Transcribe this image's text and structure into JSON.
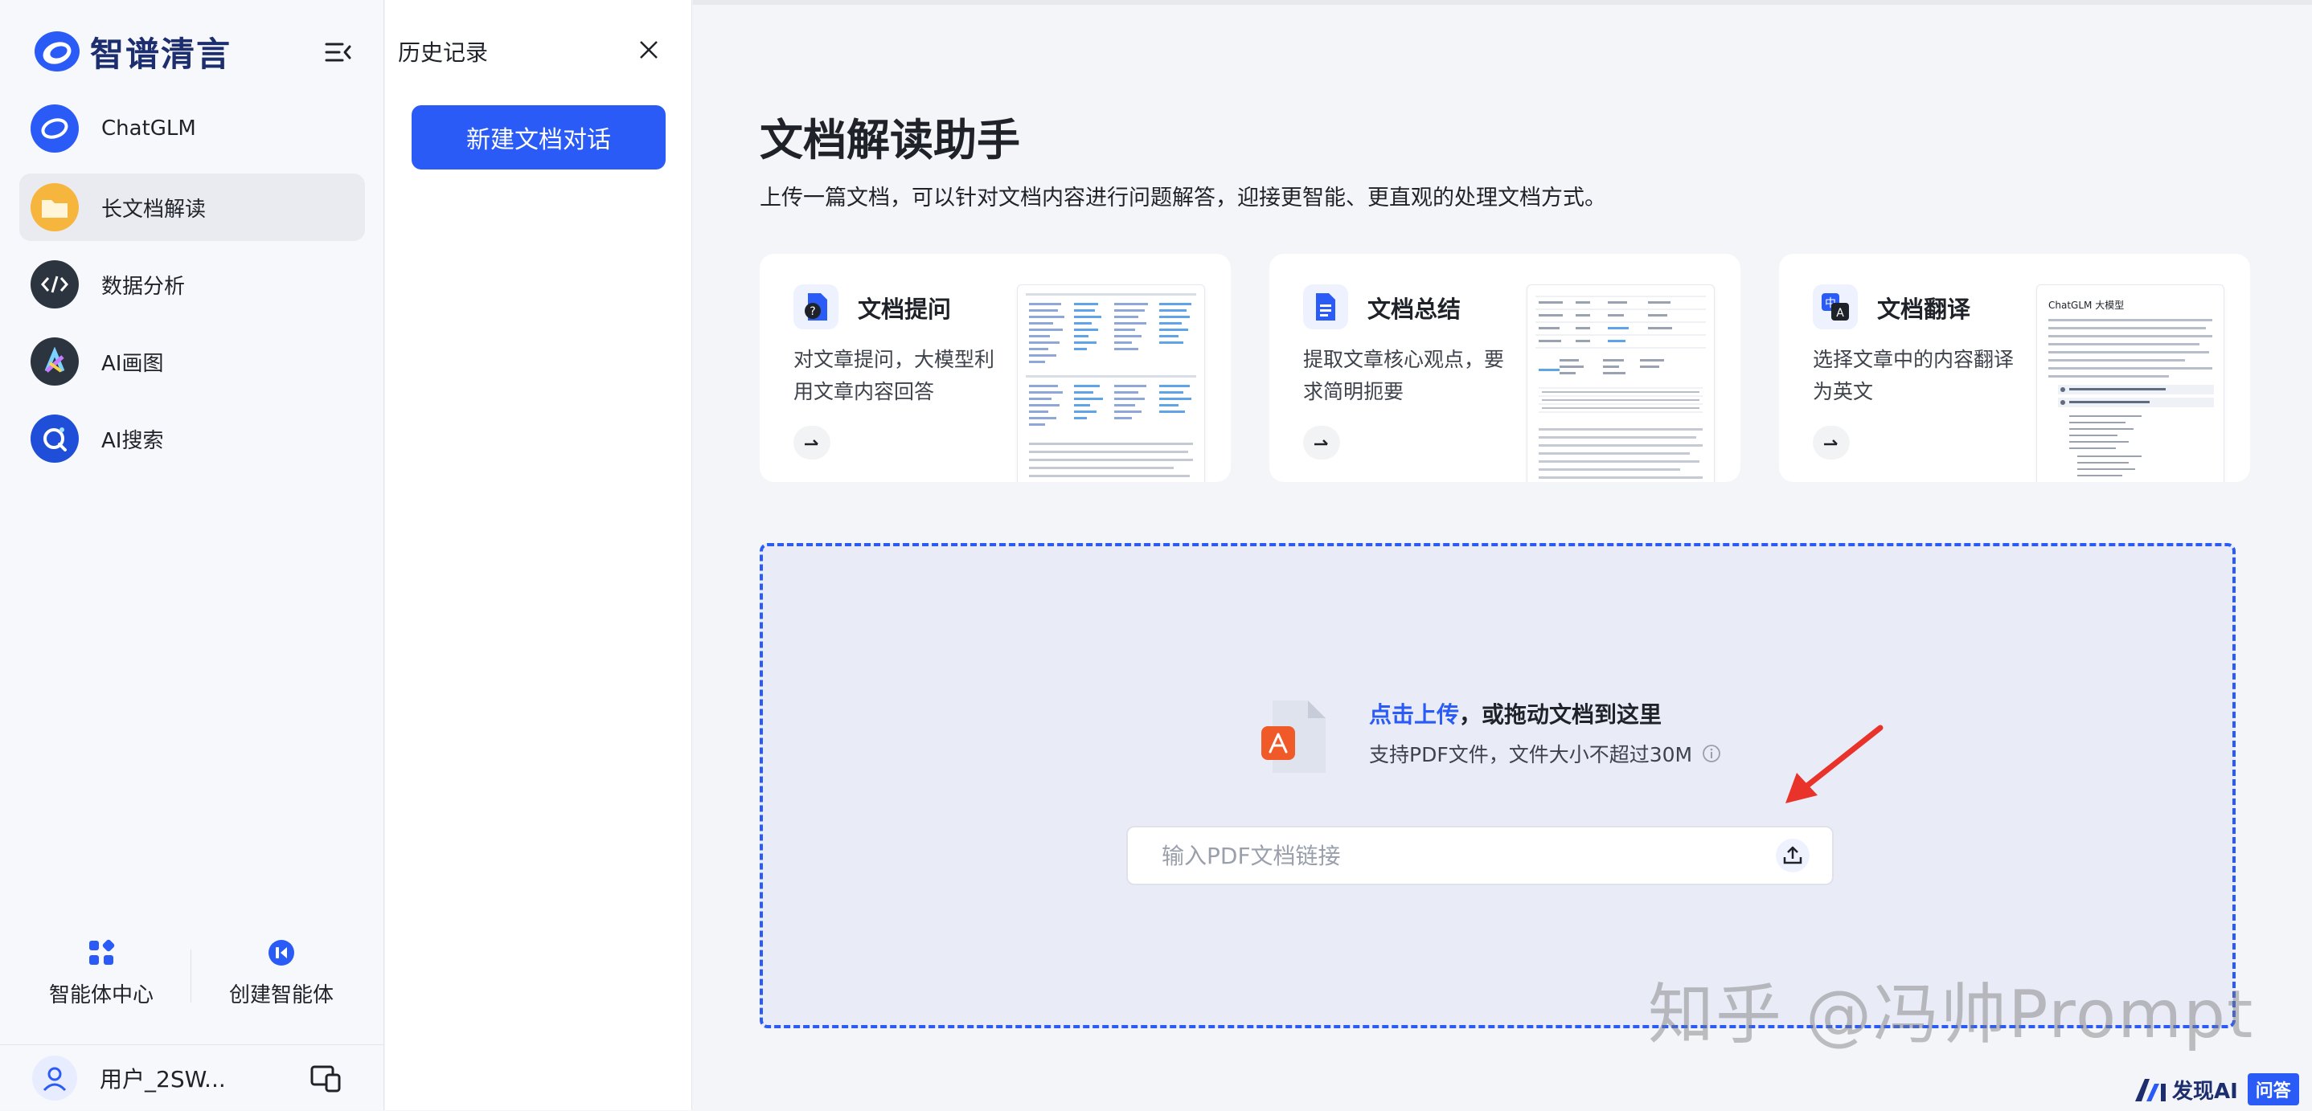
{
  "sidebar": {
    "brand": "智谱清言",
    "nav": [
      {
        "label": "ChatGLM",
        "icon": "chatglm-logo-icon",
        "active": false
      },
      {
        "label": "长文档解读",
        "icon": "folder-icon",
        "active": true
      },
      {
        "label": "数据分析",
        "icon": "code-icon",
        "active": false
      },
      {
        "label": "AI画图",
        "icon": "ai-paint-icon",
        "active": false
      },
      {
        "label": "AI搜索",
        "icon": "ai-search-icon",
        "active": false
      }
    ],
    "bottom": [
      {
        "label": "智能体中心",
        "icon": "apps-grid-icon"
      },
      {
        "label": "创建智能体",
        "icon": "create-agent-icon"
      }
    ],
    "user": {
      "name": "用户_2SW..."
    }
  },
  "history": {
    "title": "历史记录",
    "new_button": "新建文档对话"
  },
  "main": {
    "title": "文档解读助手",
    "subtitle": "上传一篇文档，可以针对文档内容进行问题解答，迎接更智能、更直观的处理文档方式。",
    "cards": [
      {
        "title": "文档提问",
        "desc": "对文章提问，大模型利用文章内容回答",
        "icon": "doc-question-icon"
      },
      {
        "title": "文档总结",
        "desc": "提取文章核心观点，要求简明扼要",
        "icon": "doc-summary-icon"
      },
      {
        "title": "文档翻译",
        "desc": "选择文章中的内容翻译为英文",
        "icon": "doc-translate-icon",
        "thumb_heading": "ChatGLM 大模型"
      }
    ],
    "upload": {
      "link_text": "点击上传",
      "rest_text": "，或拖动文档到这里",
      "support": "支持PDF文件，文件大小不超过30M",
      "input_placeholder": "输入PDF文档链接"
    }
  },
  "overlay": {
    "watermark": "知乎 @冯帅Prompt",
    "badge_brand": "发现AI",
    "badge_tag": "问答"
  },
  "colors": {
    "accent": "#2b5bf6",
    "brand_navy": "#1d2e6e",
    "arrow_red": "#e8322a"
  }
}
